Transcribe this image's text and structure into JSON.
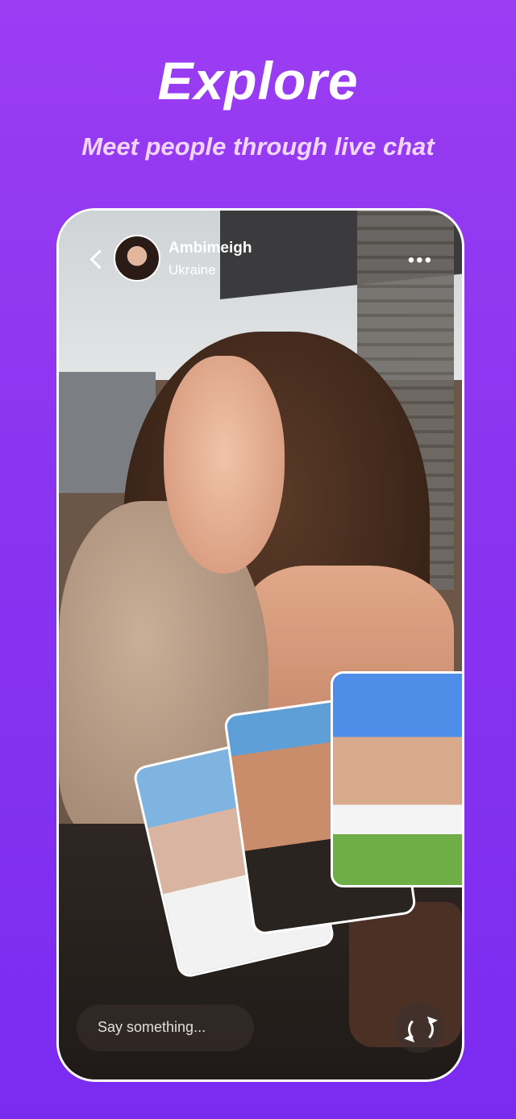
{
  "header": {
    "title": "Explore",
    "subtitle": "Meet people through live chat"
  },
  "call": {
    "back_icon": "chevron-left-icon",
    "user_name": "Ambimeigh",
    "user_country": "Ukraine",
    "more_icon": "more-icon"
  },
  "input": {
    "placeholder": "Say something..."
  },
  "switch_icon": "refresh-icon",
  "colors": {
    "background_top": "#9b3df3",
    "background_bottom": "#7b2bf0"
  }
}
